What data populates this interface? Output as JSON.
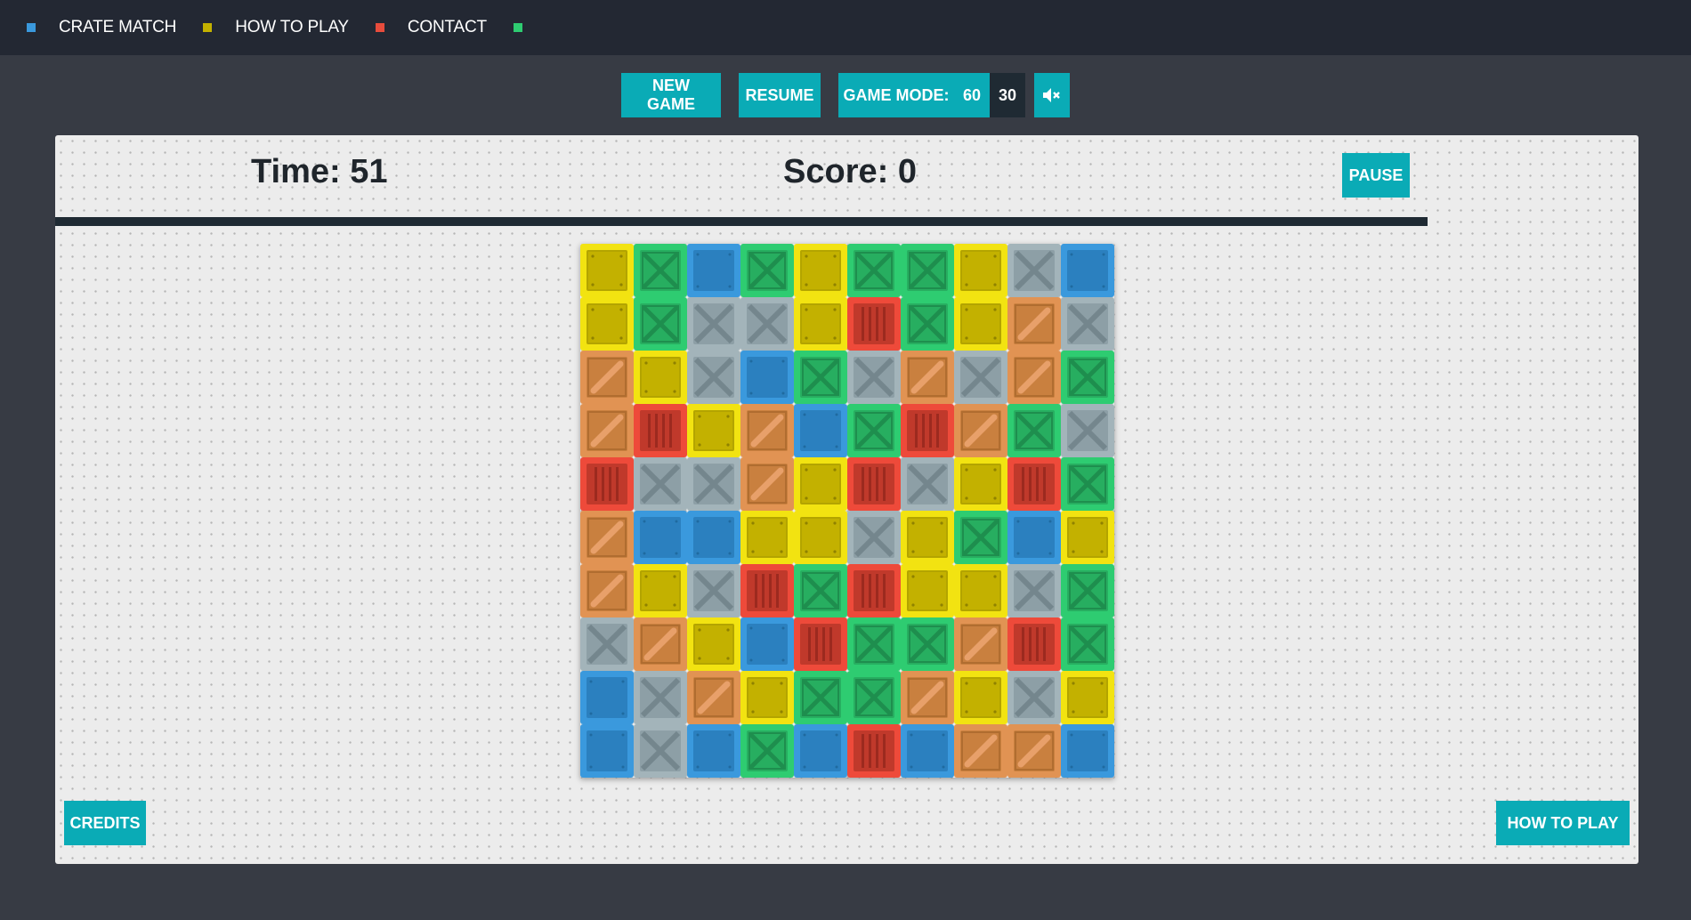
{
  "nav": {
    "items": [
      {
        "label": "CRATE MATCH",
        "dot_color": "#3a99dd"
      },
      {
        "label": "HOW TO PLAY",
        "dot_color": "#c3b100"
      },
      {
        "label": "CONTACT",
        "dot_color": "#e74c3c"
      }
    ],
    "trailing_dot_color": "#2ecc71"
  },
  "controls": {
    "new_game": "NEW GAME",
    "resume": "RESUME",
    "game_mode_label": "GAME MODE:",
    "mode_options": [
      "60",
      "30"
    ],
    "selected_mode": "60",
    "mute_icon": "speaker-muted-icon"
  },
  "hud": {
    "time": "Time: 51",
    "score": "Score: 0",
    "pause": "PAUSE",
    "timer_fraction": 1.0
  },
  "board": {
    "rows": 10,
    "cols": 10,
    "colors": {
      "Y": "yellow",
      "G": "green",
      "B": "blue",
      "S": "gray",
      "O": "orange",
      "R": "red"
    },
    "grid": [
      [
        "Y",
        "G",
        "B",
        "G",
        "Y",
        "G",
        "G",
        "Y",
        "S",
        "B"
      ],
      [
        "Y",
        "G",
        "S",
        "S",
        "Y",
        "R",
        "G",
        "Y",
        "O",
        "S"
      ],
      [
        "O",
        "Y",
        "S",
        "B",
        "G",
        "S",
        "O",
        "S",
        "O",
        "G"
      ],
      [
        "O",
        "R",
        "Y",
        "O",
        "B",
        "G",
        "R",
        "O",
        "G",
        "S"
      ],
      [
        "R",
        "S",
        "S",
        "O",
        "Y",
        "R",
        "S",
        "Y",
        "R",
        "G"
      ],
      [
        "O",
        "B",
        "B",
        "Y",
        "Y",
        "S",
        "Y",
        "G",
        "B",
        "Y"
      ],
      [
        "O",
        "Y",
        "S",
        "R",
        "G",
        "R",
        "Y",
        "Y",
        "S",
        "G"
      ],
      [
        "S",
        "O",
        "Y",
        "B",
        "R",
        "G",
        "G",
        "O",
        "R",
        "G"
      ],
      [
        "B",
        "S",
        "O",
        "Y",
        "G",
        "G",
        "O",
        "Y",
        "S",
        "Y"
      ],
      [
        "B",
        "S",
        "B",
        "G",
        "B",
        "R",
        "B",
        "O",
        "O",
        "B"
      ]
    ]
  },
  "footer": {
    "credits": "CREDITS",
    "how_to_play": "HOW TO PLAY"
  }
}
